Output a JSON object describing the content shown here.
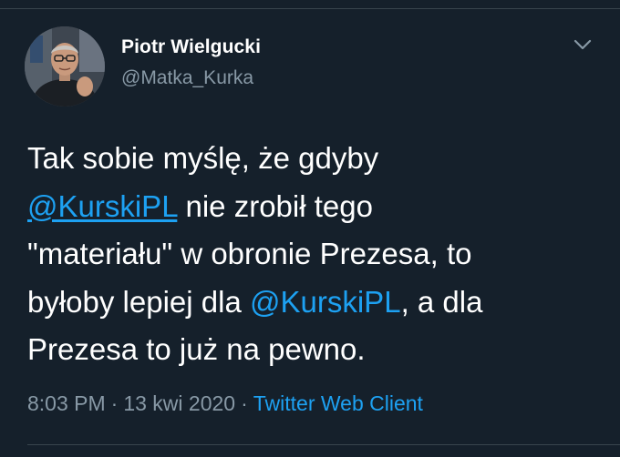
{
  "tweet": {
    "author": {
      "display_name": "Piotr Wielgucki",
      "handle": "@Matka_Kurka"
    },
    "text": {
      "line1": "Tak sobie myślę, że gdyby",
      "mention1": "@KurskiPL",
      "line2_rest": " nie zrobił tego",
      "line3": "\"materiału\" w obronie Prezesa, to",
      "line4_start": "byłoby lepiej dla ",
      "mention2": "@KurskiPL",
      "line4_rest": ", a dla",
      "line5": "Prezesa to już na pewno."
    },
    "meta": {
      "time": "8:03 PM",
      "separator": "·",
      "date": "13 kwi 2020",
      "client": "Twitter Web Client"
    },
    "icons": {
      "menu": "chevron-down-icon",
      "avatar": "profile-photo"
    },
    "colors": {
      "background": "#15202b",
      "link": "#1da1f2",
      "secondary_text": "#8899a6",
      "divider": "#38444d"
    }
  }
}
